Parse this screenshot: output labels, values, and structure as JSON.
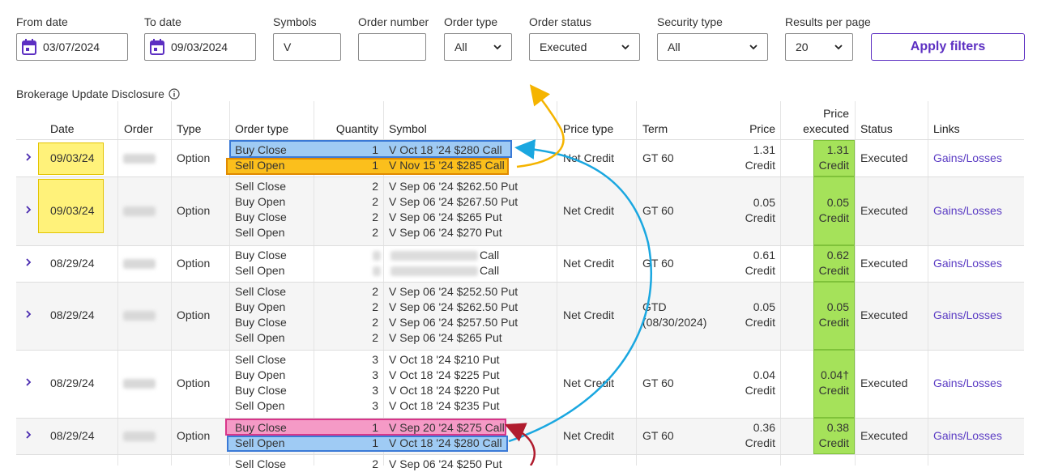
{
  "filters": {
    "from_date": {
      "label": "From date",
      "value": "03/07/2024"
    },
    "to_date": {
      "label": "To date",
      "value": "09/03/2024"
    },
    "symbols": {
      "label": "Symbols",
      "value": "V"
    },
    "order_number": {
      "label": "Order number",
      "value": ""
    },
    "order_type": {
      "label": "Order type",
      "value": "All"
    },
    "order_status": {
      "label": "Order status",
      "value": "Executed"
    },
    "security_type": {
      "label": "Security type",
      "value": "All"
    },
    "results_per_page": {
      "label": "Results per page",
      "value": "20"
    },
    "apply_label": "Apply filters"
  },
  "disclosure": "Brokerage Update Disclosure",
  "table": {
    "headers": {
      "date": "Date",
      "order": "Order",
      "type": "Type",
      "order_type": "Order type",
      "quantity": "Quantity",
      "symbol": "Symbol",
      "price_type": "Price type",
      "term": "Term",
      "price": "Price",
      "price_executed_1": "Price",
      "price_executed_2": "executed",
      "status": "Status",
      "links": "Links"
    },
    "rows": [
      {
        "date": "09/03/24",
        "type": "Option",
        "legs": [
          {
            "order_type": "Buy Close",
            "qty": "1",
            "symbol": "V Oct 18 '24 $280 Call"
          },
          {
            "order_type": "Sell Open",
            "qty": "1",
            "symbol": "V Nov 15 '24 $285 Call"
          }
        ],
        "price_type": "Net Credit",
        "term": "GT 60",
        "term2": "",
        "price": "1.31",
        "price_unit": "Credit",
        "executed": "1.31",
        "executed_unit": "Credit",
        "status": "Executed",
        "link": "Gains/Losses"
      },
      {
        "date": "09/03/24",
        "type": "Option",
        "legs": [
          {
            "order_type": "Sell Close",
            "qty": "2",
            "symbol": "V Sep 06 '24 $262.50 Put"
          },
          {
            "order_type": "Buy Open",
            "qty": "2",
            "symbol": "V Sep 06 '24 $267.50 Put"
          },
          {
            "order_type": "Buy Close",
            "qty": "2",
            "symbol": "V Sep 06 '24 $265 Put"
          },
          {
            "order_type": "Sell Open",
            "qty": "2",
            "symbol": "V Sep 06 '24 $270 Put"
          }
        ],
        "price_type": "Net Credit",
        "term": "GT 60",
        "term2": "",
        "price": "0.05",
        "price_unit": "Credit",
        "executed": "0.05",
        "executed_unit": "Credit",
        "status": "Executed",
        "link": "Gains/Losses"
      },
      {
        "date": "08/29/24",
        "type": "Option",
        "legs": [
          {
            "order_type": "Buy Close",
            "qty": "",
            "symbol": "Call"
          },
          {
            "order_type": "Sell Open",
            "qty": "",
            "symbol": "Call"
          }
        ],
        "price_type": "Net Credit",
        "term": "GT 60",
        "term2": "",
        "price": "0.61",
        "price_unit": "Credit",
        "executed": "0.62",
        "executed_unit": "Credit",
        "status": "Executed",
        "link": "Gains/Losses"
      },
      {
        "date": "08/29/24",
        "type": "Option",
        "legs": [
          {
            "order_type": "Sell Close",
            "qty": "2",
            "symbol": "V Sep 06 '24 $252.50 Put"
          },
          {
            "order_type": "Buy Open",
            "qty": "2",
            "symbol": "V Sep 06 '24 $262.50 Put"
          },
          {
            "order_type": "Buy Close",
            "qty": "2",
            "symbol": "V Sep 06 '24 $257.50 Put"
          },
          {
            "order_type": "Sell Open",
            "qty": "2",
            "symbol": "V Sep 06 '24 $265 Put"
          }
        ],
        "price_type": "Net Credit",
        "term": "GTD",
        "term2": "(08/30/2024)",
        "price": "0.05",
        "price_unit": "Credit",
        "executed": "0.05",
        "executed_unit": "Credit",
        "status": "Executed",
        "link": "Gains/Losses"
      },
      {
        "date": "08/29/24",
        "type": "Option",
        "legs": [
          {
            "order_type": "Sell Close",
            "qty": "3",
            "symbol": "V Oct 18 '24 $210 Put"
          },
          {
            "order_type": "Buy Open",
            "qty": "3",
            "symbol": "V Oct 18 '24 $225 Put"
          },
          {
            "order_type": "Buy Close",
            "qty": "3",
            "symbol": "V Oct 18 '24 $220 Put"
          },
          {
            "order_type": "Sell Open",
            "qty": "3",
            "symbol": "V Oct 18 '24 $235 Put"
          }
        ],
        "price_type": "Net Credit",
        "term": "GT 60",
        "term2": "",
        "price": "0.04",
        "price_unit": "Credit",
        "executed": "0.04†",
        "executed_unit": "Credit",
        "status": "Executed",
        "link": "Gains/Losses"
      },
      {
        "date": "08/29/24",
        "type": "Option",
        "legs": [
          {
            "order_type": "Buy Close",
            "qty": "1",
            "symbol": "V Sep 20 '24 $275 Call"
          },
          {
            "order_type": "Sell Open",
            "qty": "1",
            "symbol": "V Oct 18 '24 $280 Call"
          }
        ],
        "price_type": "Net Credit",
        "term": "GT 60",
        "term2": "",
        "price": "0.36",
        "price_unit": "Credit",
        "executed": "0.38",
        "executed_unit": "Credit",
        "status": "Executed",
        "link": "Gains/Losses"
      },
      {
        "date": "",
        "type": "",
        "legs": [
          {
            "order_type": "Sell Close",
            "qty": "2",
            "symbol": "V Sep 06 '24 $250 Put"
          }
        ],
        "price_type": "",
        "term": "",
        "term2": "",
        "price": "",
        "price_unit": "",
        "executed": "",
        "executed_unit": "",
        "status": "",
        "link": ""
      }
    ]
  },
  "colors": {
    "accent": "#5c2fc2",
    "highlight_yellow": "#fff27a",
    "highlight_green": "#a5e25a",
    "highlight_blue": "#9fcbf4",
    "highlight_orange": "#fbbf1c",
    "highlight_pink": "#f59ac6",
    "arrow_blue": "#1aa7e0",
    "arrow_orange": "#f5b400",
    "arrow_red": "#b01c2e"
  },
  "icons": [
    "calendar-icon",
    "chevron-down-icon",
    "info-icon",
    "chevron-right-icon"
  ]
}
